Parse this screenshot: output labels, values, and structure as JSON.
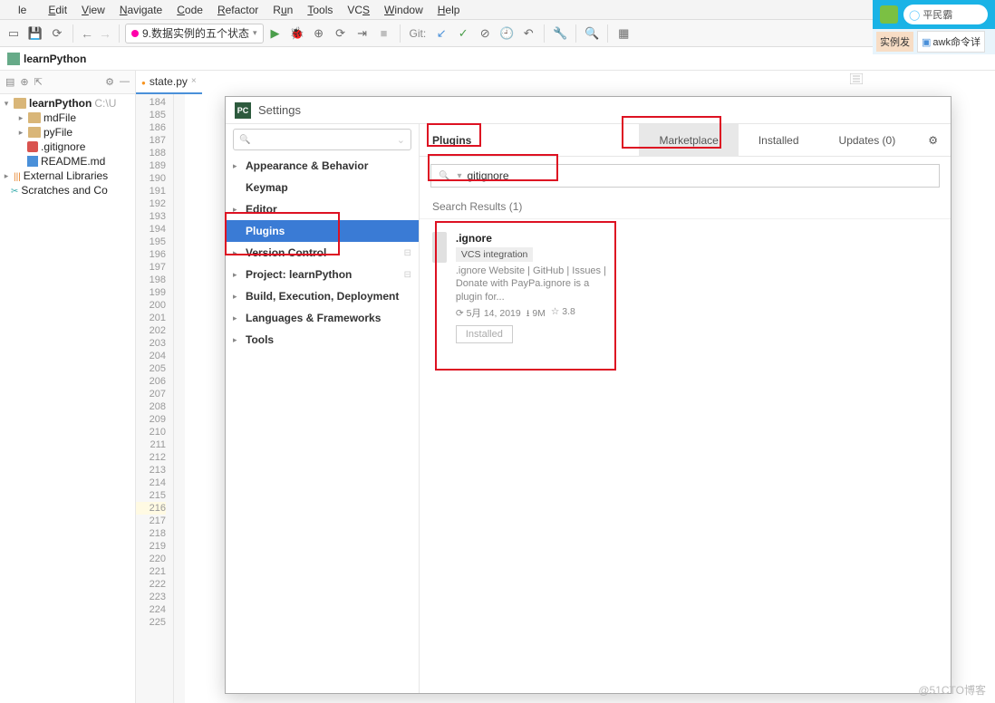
{
  "menu": {
    "items": [
      "le",
      "Edit",
      "View",
      "Navigate",
      "Code",
      "Refactor",
      "Run",
      "Tools",
      "VCS",
      "Window",
      "Help"
    ],
    "underline": [
      false,
      true,
      true,
      true,
      true,
      true,
      true,
      true,
      true,
      true,
      true
    ]
  },
  "runConfig": "9.数据实例的五个状态",
  "gitLabel": "Git:",
  "breadcrumb": {
    "project": "learnPython"
  },
  "projectTree": {
    "root": "learnPython",
    "rootHint": "C:\\U",
    "children": [
      {
        "name": "mdFile",
        "type": "folder"
      },
      {
        "name": "pyFile",
        "type": "folder"
      },
      {
        "name": ".gitignore",
        "type": "gitignore"
      },
      {
        "name": "README.md",
        "type": "md"
      }
    ],
    "external": "External Libraries",
    "scratches": "Scratches and Co"
  },
  "tab": {
    "name": "state.py"
  },
  "lineStart": 184,
  "lineEnd": 225,
  "highlightLine": 216,
  "settings": {
    "title": "Settings",
    "searchPlaceholder": "",
    "categories": [
      {
        "label": "Appearance & Behavior",
        "expandable": true,
        "bold": true
      },
      {
        "label": "Keymap",
        "expandable": false,
        "bold": true
      },
      {
        "label": "Editor",
        "expandable": true,
        "bold": true
      },
      {
        "label": "Plugins",
        "expandable": false,
        "bold": true,
        "active": true
      },
      {
        "label": "Version Control",
        "expandable": true,
        "bold": true,
        "disk": true
      },
      {
        "label": "Project: learnPython",
        "expandable": true,
        "bold": true,
        "disk": true
      },
      {
        "label": "Build, Execution, Deployment",
        "expandable": true,
        "bold": true
      },
      {
        "label": "Languages & Frameworks",
        "expandable": true,
        "bold": true
      },
      {
        "label": "Tools",
        "expandable": true,
        "bold": true
      }
    ],
    "plugins": {
      "heading": "Plugins",
      "tabs": {
        "market": "Marketplace",
        "installed": "Installed",
        "updates": "Updates (0)"
      },
      "searchValue": "gitignore",
      "resultsLabel": "Search Results (1)",
      "result": {
        "name": ".ignore",
        "tag": "VCS integration",
        "desc": ".ignore Website | GitHub | Issues | Donate with PayPa.ignore is a plugin for...",
        "date": "5月 14, 2019",
        "downloads": "9M",
        "rating": "3.8",
        "status": "Installed"
      }
    }
  },
  "rightEdge": {
    "search": "平民霸",
    "tab1": "实例发",
    "tab2": "awk命令详"
  },
  "watermark": "@51CTO博客"
}
